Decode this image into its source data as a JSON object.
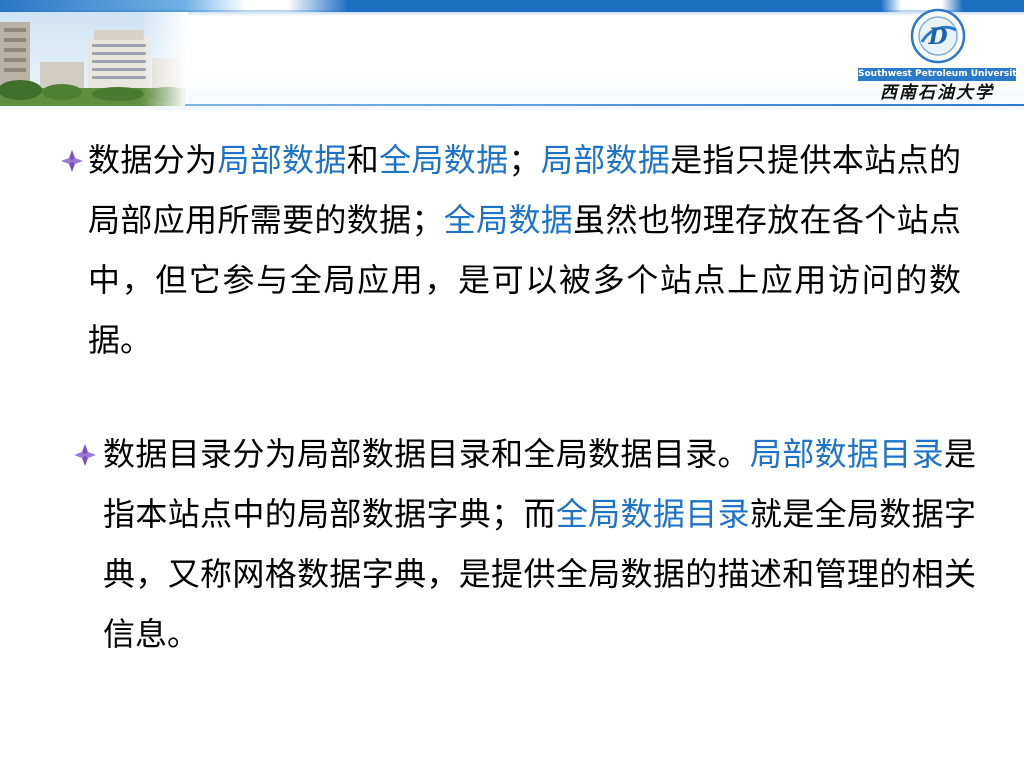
{
  "header": {
    "logo_en": "Southwest Petroleum University",
    "logo_cn": "西南石油大学",
    "emblem_letter": "D"
  },
  "colors": {
    "accent_blue": "#1e73c6",
    "header_blue": "#1d6fc2",
    "bullet_purple": "#7b4fc4"
  },
  "icons": {
    "bullet": "four-point-diamond-bullet-icon",
    "emblem": "university-emblem-icon"
  },
  "content": {
    "paragraphs": [
      {
        "segments": [
          {
            "text": "数据分为",
            "highlight": false
          },
          {
            "text": "局部数据",
            "highlight": true
          },
          {
            "text": "和",
            "highlight": false
          },
          {
            "text": "全局数据",
            "highlight": true
          },
          {
            "text": "；",
            "highlight": false
          },
          {
            "text": "局部数据",
            "highlight": true
          },
          {
            "text": "是指只提供本站点的局部应用所需要的数据；",
            "highlight": false
          },
          {
            "text": "全局数据",
            "highlight": true
          },
          {
            "text": "虽然也物理存放在各个站点中，但它参与全局应用，是可以被多个站点上应用访问的数据。",
            "highlight": false
          }
        ]
      },
      {
        "segments": [
          {
            "text": "数据目录分为局部数据目录和全局数据目录。",
            "highlight": false
          },
          {
            "text": "局部数据目录",
            "highlight": true
          },
          {
            "text": "是指本站点中的局部数据字典；而",
            "highlight": false
          },
          {
            "text": "全局数据目录",
            "highlight": true
          },
          {
            "text": "就是全局数据字典，又称网格数据字典，是提供全局数据的描述和管理的相关信息。",
            "highlight": false
          }
        ]
      }
    ]
  }
}
